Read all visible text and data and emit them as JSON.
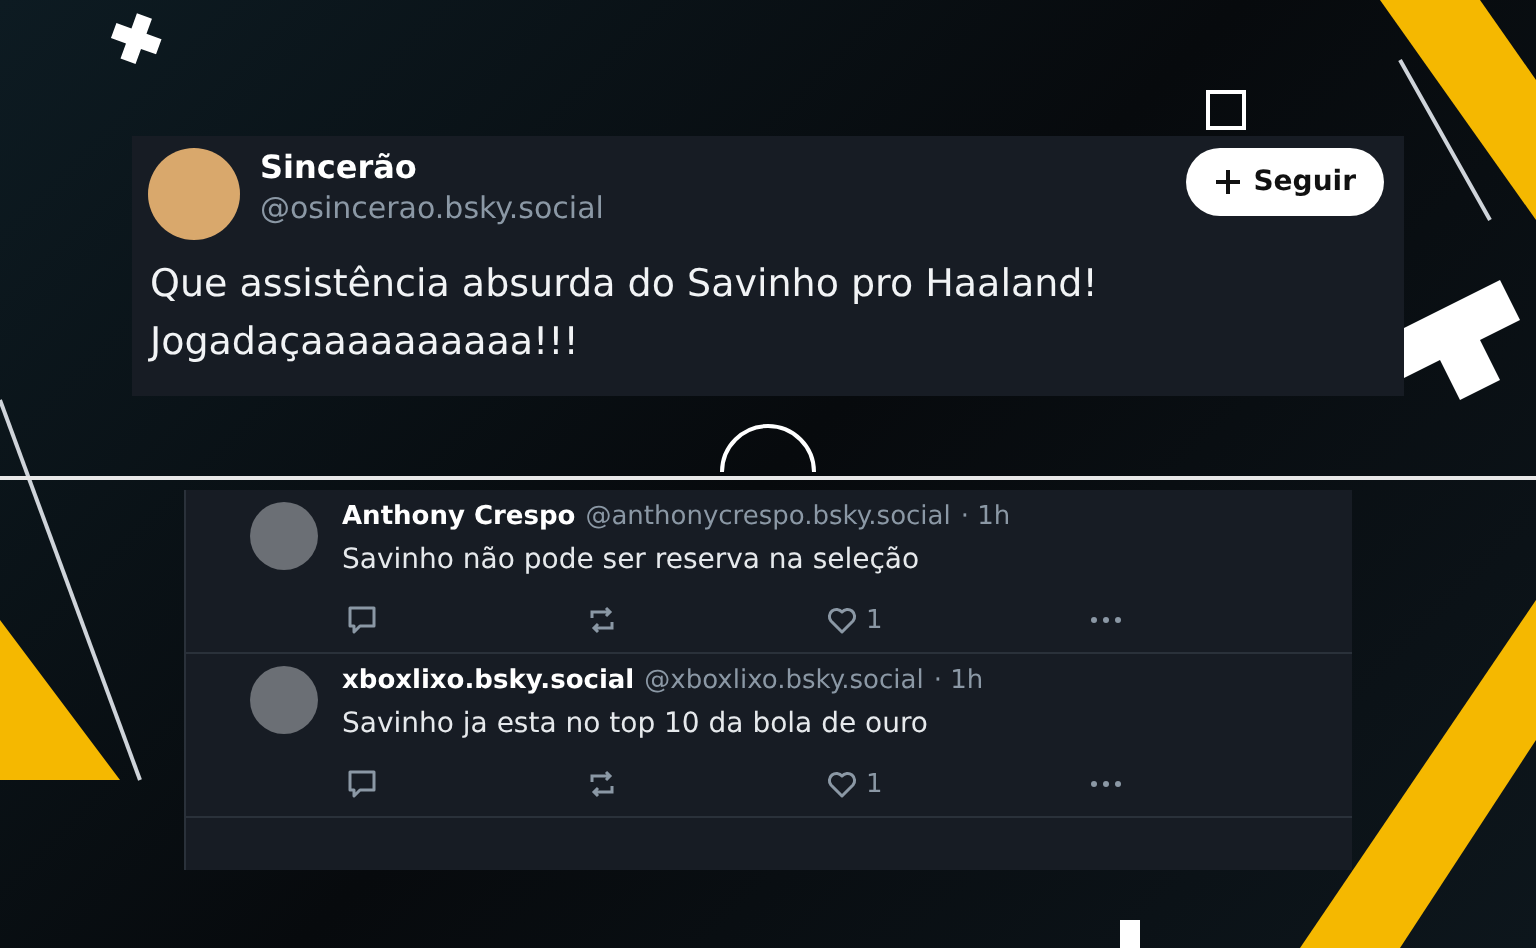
{
  "post": {
    "author": "Sincerão",
    "handle": "@osincerao.bsky.social",
    "follow_label": "Seguir",
    "text": "Que assistência absurda do Savinho pro Haaland! Jogadaçaaaaaaaaaa!!!"
  },
  "replies": [
    {
      "author": "Anthony Crespo",
      "handle": "@anthonycrespo.bsky.social",
      "time": "· 1h",
      "text": "Savinho não pode ser reserva na seleção",
      "likes": "1"
    },
    {
      "author": "xboxlixo.bsky.social",
      "handle": "@xboxlixo.bsky.social",
      "time": "· 1h",
      "text": "Savinho ja esta no top 10 da bola de ouro",
      "likes": "1"
    }
  ]
}
